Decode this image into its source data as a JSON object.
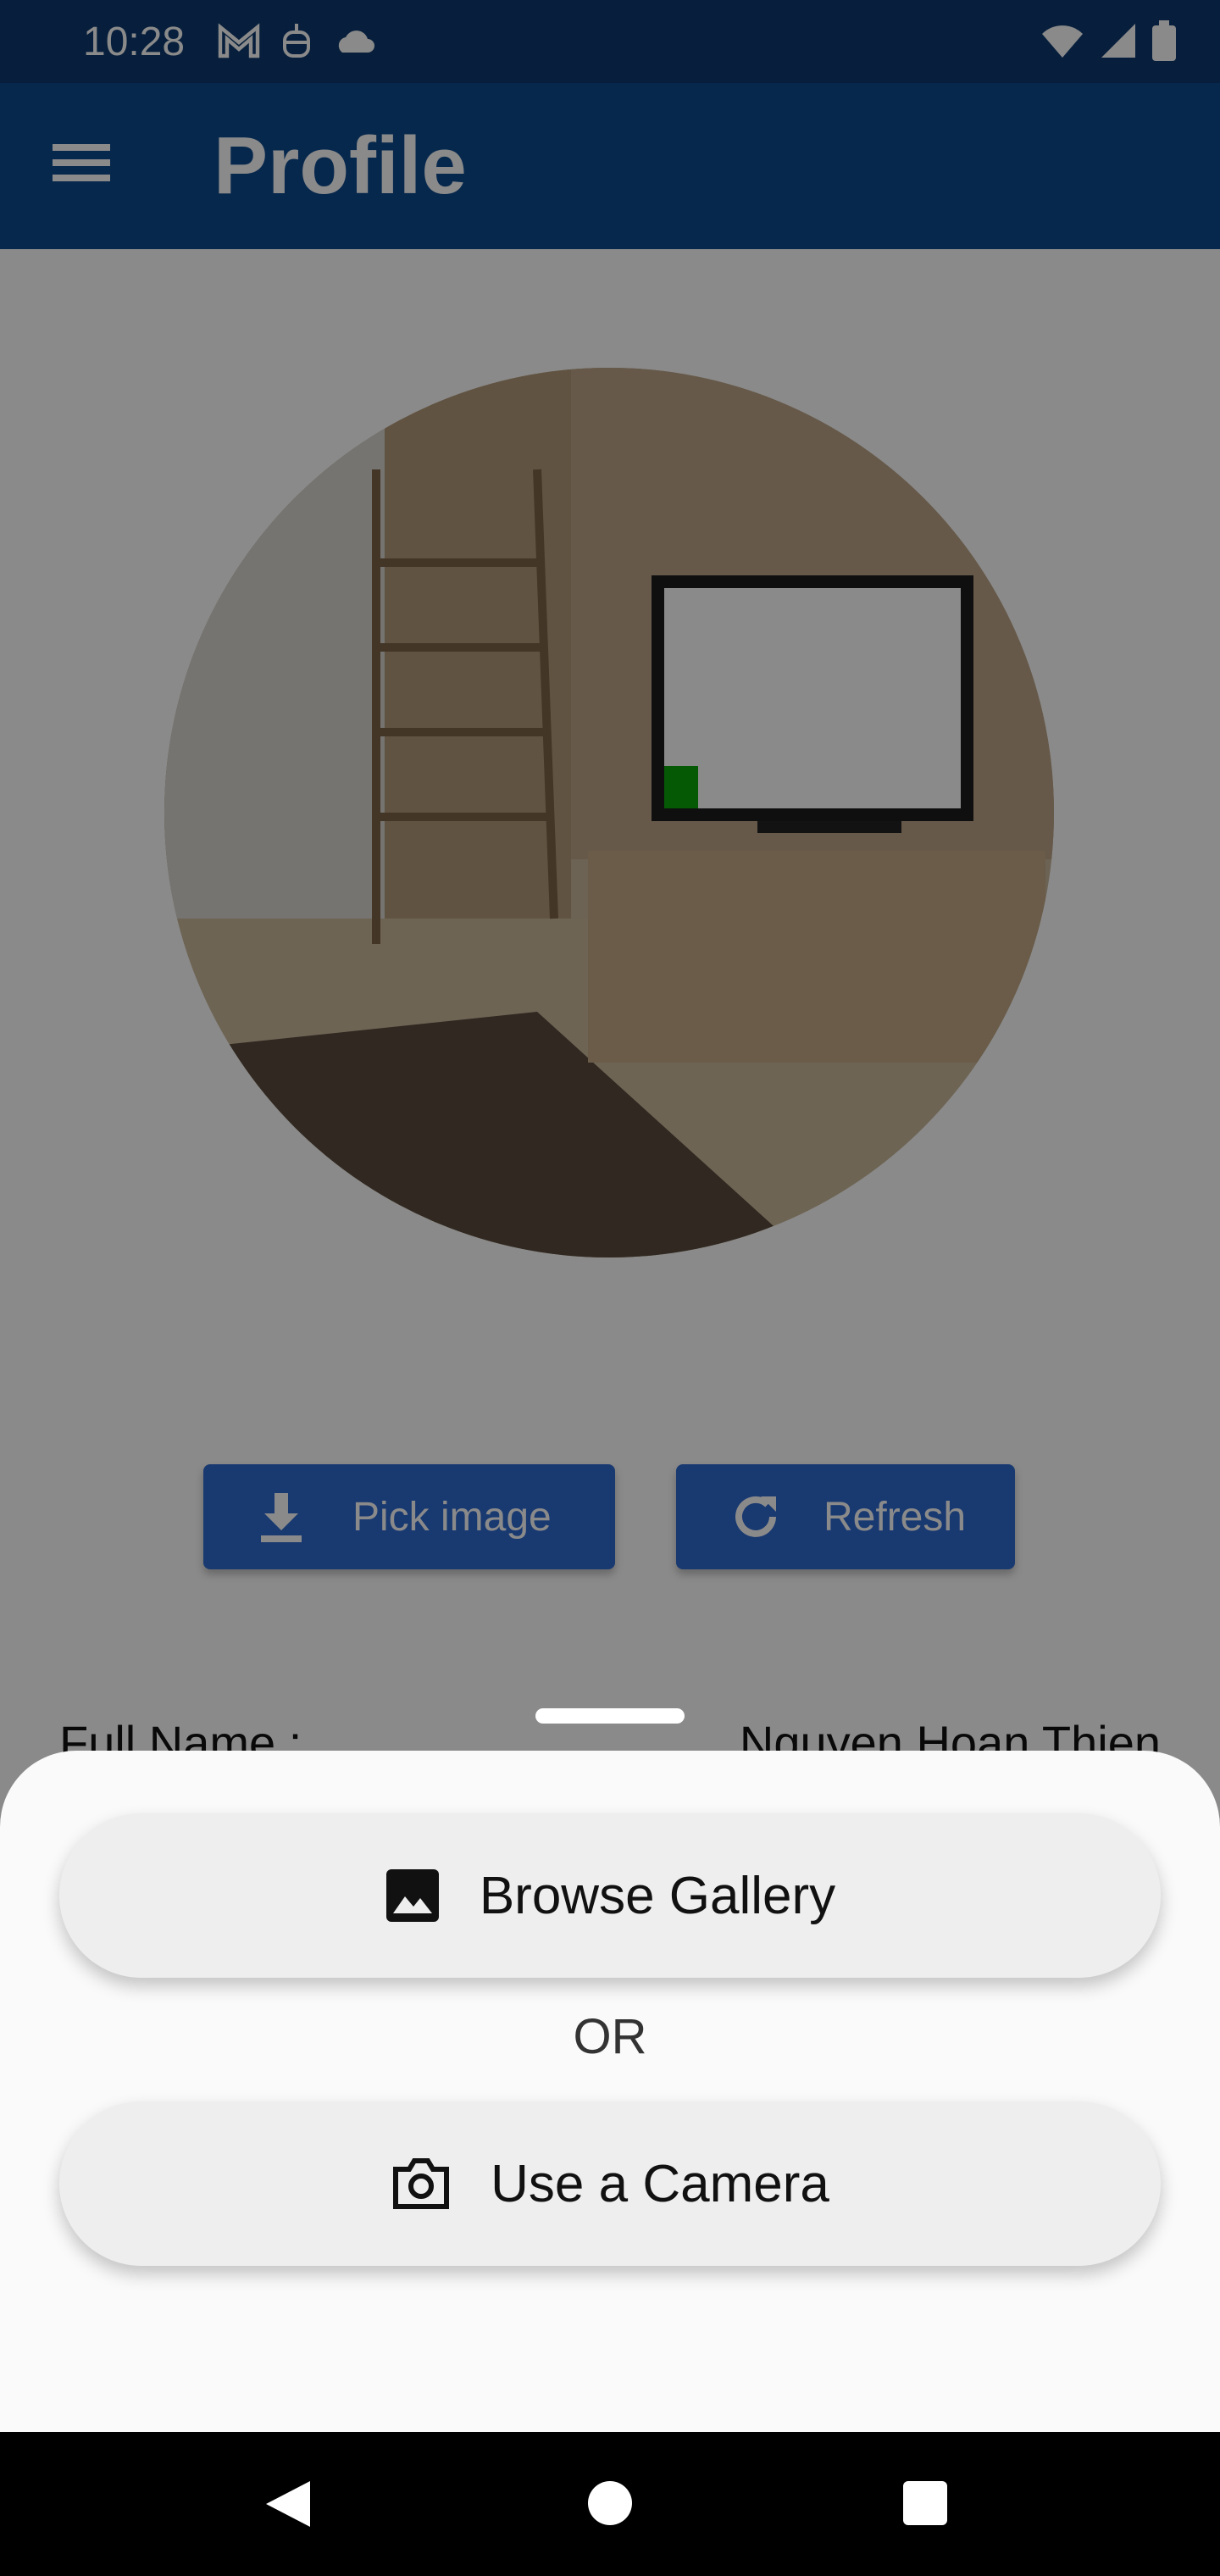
{
  "status_bar": {
    "time": "10:28",
    "left_icons": [
      "gmail-icon",
      "bot-icon",
      "cloud-icon"
    ],
    "right_icons": [
      "wifi-icon",
      "signal-icon",
      "battery-icon"
    ]
  },
  "app_bar": {
    "title": "Profile",
    "menu_icon": "menu-icon",
    "background": "#0d4a8f"
  },
  "profile": {
    "avatar_description_icon": "profile-photo",
    "pick_image_label": "Pick image",
    "refresh_label": "Refresh",
    "full_name_label": "Full Name :",
    "full_name_value": "Nguyen Hoan Thien"
  },
  "bottom_sheet": {
    "gallery_label": "Browse Gallery",
    "or_text": "OR",
    "camera_label": "Use a Camera"
  },
  "colors": {
    "accent": "#2f6ad1",
    "status_bar": "#0d3a70",
    "sheet": "#fafafa",
    "sheet_button": "#eeeeee"
  }
}
